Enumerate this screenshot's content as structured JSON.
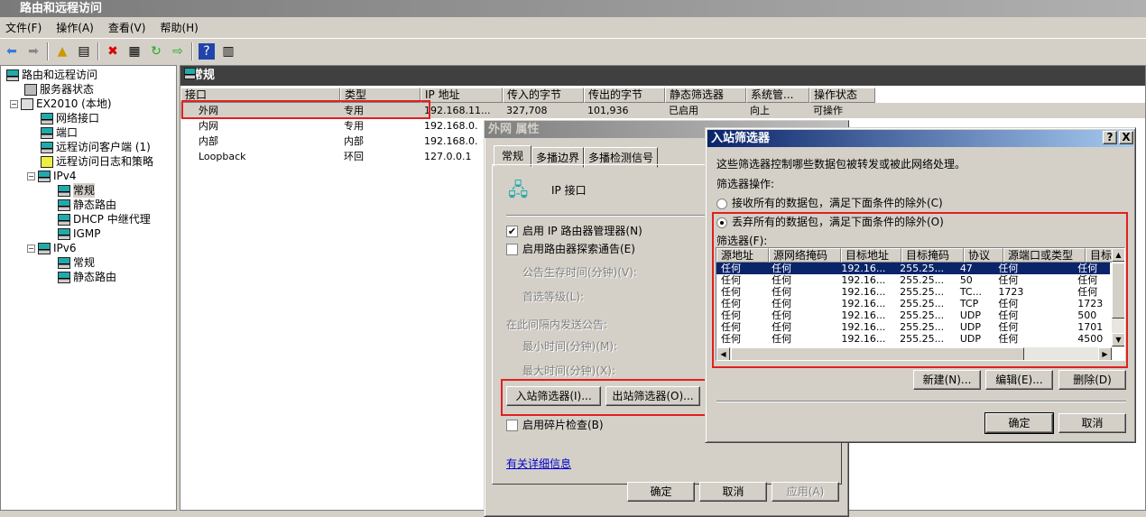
{
  "window": {
    "title": "路由和远程访问"
  },
  "menu": [
    "文件(F)",
    "操作(A)",
    "查看(V)",
    "帮助(H)"
  ],
  "tree": {
    "root": "路由和远程访问",
    "server_status": "服务器状态",
    "server": "EX2010 (本地)",
    "items": [
      "网络接口",
      "端口",
      "远程访问客户端 (1)",
      "远程访问日志和策略"
    ],
    "ipv4": "IPv4",
    "ipv4_items": [
      "常规",
      "静态路由",
      "DHCP 中继代理",
      "IGMP"
    ],
    "ipv6": "IPv6",
    "ipv6_items": [
      "常规",
      "静态路由"
    ]
  },
  "right": {
    "header": "常规",
    "columns": [
      "接口",
      "类型",
      "IP 地址",
      "传入的字节",
      "传出的字节",
      "静态筛选器",
      "系统管...",
      "操作状态"
    ],
    "rows": [
      [
        "外网",
        "专用",
        "192.168.11...",
        "327,708",
        "101,936",
        "已启用",
        "向上",
        "可操作"
      ],
      [
        "内网",
        "专用",
        "192.168.0.",
        "",
        "",
        "",
        "",
        ""
      ],
      [
        "内部",
        "内部",
        "192.168.0.",
        "",
        "",
        "",
        "",
        ""
      ],
      [
        "Loopback",
        "环回",
        "127.0.0.1",
        "",
        "",
        "",
        "",
        ""
      ]
    ]
  },
  "props": {
    "title": "外网 属性",
    "tabs": [
      "常规",
      "多播边界",
      "多播检测信号"
    ],
    "icon_label": "IP 接口",
    "enable_router": "启用 IP 路由器管理器(N)",
    "enable_discovery": "启用路由器探索通告(E)",
    "lifetime": "公告生存时间(分钟)(V):",
    "preference": "首选等级(L):",
    "interval": "在此间隔内发送公告:",
    "min_time": "最小时间(分钟)(M):",
    "max_time": "最大时间(分钟)(X):",
    "inbound": "入站筛选器(I)...",
    "outbound": "出站筛选器(O)...",
    "fragment": "启用碎片检查(B)",
    "more_info": "有关详细信息",
    "ok": "确定",
    "cancel": "取消",
    "apply": "应用(A)"
  },
  "inbound": {
    "title": "入站筛选器",
    "help": "?",
    "close": "X",
    "desc": "这些筛选器控制哪些数据包被转发或被此网络处理。",
    "action_label": "筛选器操作:",
    "accept": "接收所有的数据包，满足下面条件的除外(C)",
    "drop": "丢弃所有的数据包，满足下面条件的除外(O)",
    "filters_label": "筛选器(F):",
    "columns": [
      "源地址",
      "源网络掩码",
      "目标地址",
      "目标掩码",
      "协议",
      "源端口或类型",
      "目标"
    ],
    "rows": [
      [
        "任何",
        "任何",
        "192.16...",
        "255.25...",
        "47",
        "任何",
        "任何"
      ],
      [
        "任何",
        "任何",
        "192.16...",
        "255.25...",
        "50",
        "任何",
        "任何"
      ],
      [
        "任何",
        "任何",
        "192.16...",
        "255.25...",
        "TC...",
        "1723",
        "任何"
      ],
      [
        "任何",
        "任何",
        "192.16...",
        "255.25...",
        "TCP",
        "任何",
        "1723"
      ],
      [
        "任何",
        "任何",
        "192.16...",
        "255.25...",
        "UDP",
        "任何",
        "500"
      ],
      [
        "任何",
        "任何",
        "192.16...",
        "255.25...",
        "UDP",
        "任何",
        "1701"
      ],
      [
        "任何",
        "任何",
        "192.16...",
        "255.25...",
        "UDP",
        "任何",
        "4500"
      ]
    ],
    "new": "新建(N)...",
    "edit": "编辑(E)...",
    "delete": "删除(D)",
    "ok": "确定",
    "cancel": "取消"
  }
}
